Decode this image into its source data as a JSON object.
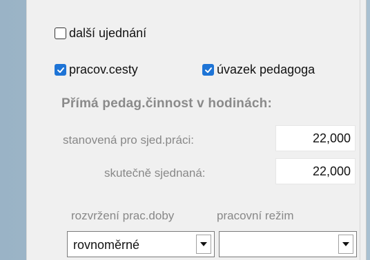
{
  "checkboxes": {
    "dalsi": {
      "label": "další ujednání",
      "checked": false
    },
    "pracov": {
      "label": "pracov.cesty",
      "checked": true
    },
    "uvazek": {
      "label": "úvazek pedagoga",
      "checked": true
    }
  },
  "section": {
    "heading": "Přímá pedag.činnost v hodinách:"
  },
  "fields": {
    "stanovena": {
      "label": "stanovená pro sjed.práci:",
      "value": "22,000"
    },
    "skutecne": {
      "label": "skutečně sjednaná:",
      "value": "22,000"
    }
  },
  "combos": {
    "rozvrzeni_label": "rozvržení prac.doby",
    "rezim_label": "pracovní režim",
    "rozvrzeni_value": "rovnoměrné",
    "rezim_value": ""
  },
  "colors": {
    "checkbox_checked": "#1e74d6",
    "heading": "#8a8a8a"
  }
}
